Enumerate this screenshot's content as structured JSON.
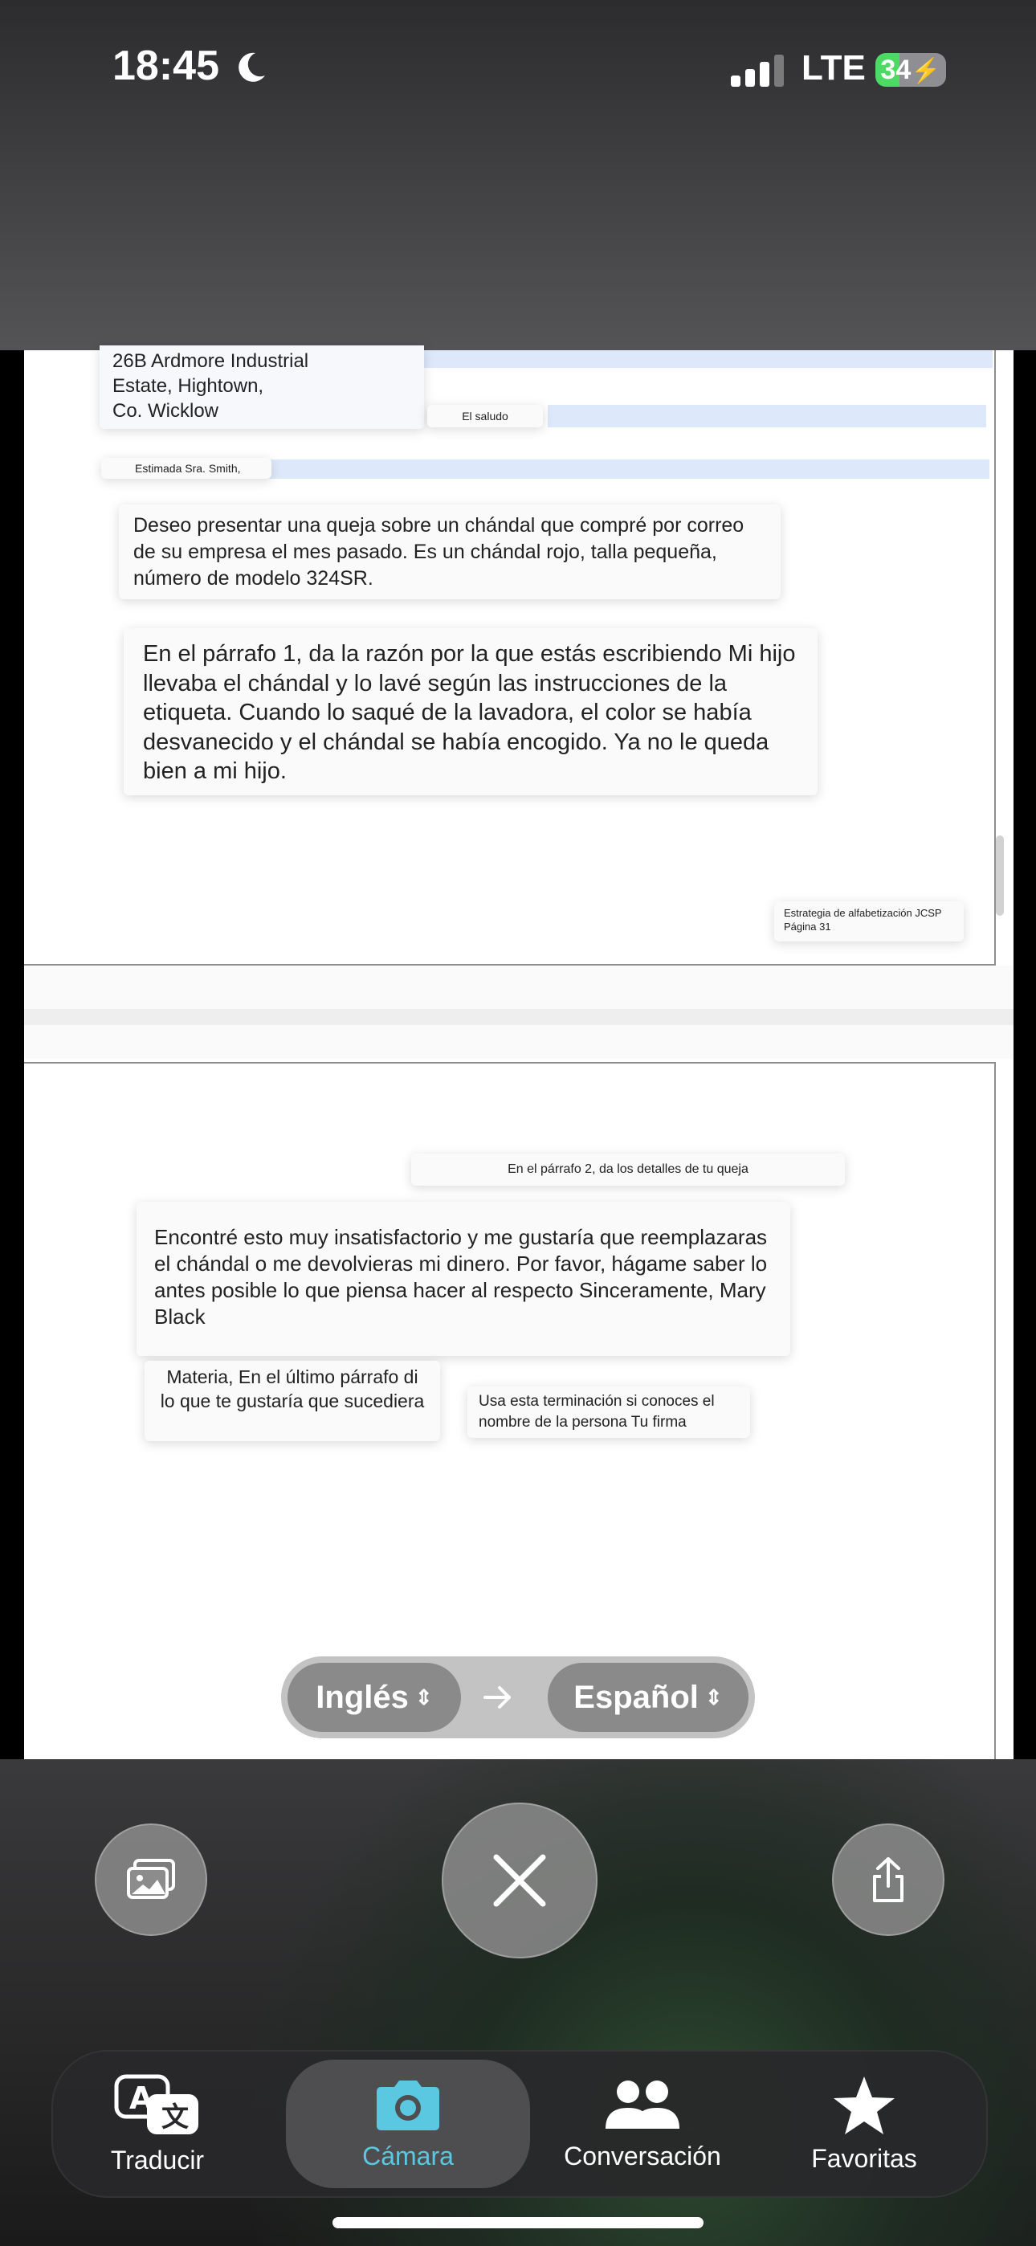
{
  "status_bar": {
    "time": "18:45",
    "network": "LTE",
    "battery": "34"
  },
  "page1": {
    "address_lines": [
      "26B Ardmore Industrial",
      "Estate, Hightown,",
      "Co. Wicklow"
    ],
    "greeting_tag": "El saludo",
    "salutation": "Estimada Sra. Smith,",
    "paragraph1": "Deseo presentar una queja sobre un chándal que compré por correo de su empresa el mes pasado. Es un chándal rojo, talla pequeña, número de modelo 324SR.",
    "paragraph2": "En el párrafo 1, da la razón por la que estás escribiendo Mi hijo llevaba el chándal y lo lavé según las instrucciones de la etiqueta. Cuando lo saqué de la lavadora, el color se había desvanecido y el chándal se había encogido. Ya no le queda bien a mi hijo.",
    "footer_lines": [
      "Estrategia de alfabetización JCSP",
      "Página 31"
    ]
  },
  "page2": {
    "paragraph2_tip": "En el párrafo 2, da los detalles de tu queja",
    "paragraph3": "Encontré esto muy insatisfactorio y me gustaría que reemplazaras el chándal o me devolvieras mi dinero. Por favor, hágame saber lo antes posible lo que piensa hacer al respecto Sinceramente, Mary Black",
    "last_paragraph_tip": "Materia, En el último párrafo di lo que te gustaría que sucediera",
    "ending_tip": "Usa esta terminación si conoces el nombre de la persona Tu firma"
  },
  "language_picker": {
    "source": "Inglés",
    "target": "Español"
  },
  "tabs": [
    {
      "label": "Traducir",
      "icon": "translate-icon"
    },
    {
      "label": "Cámara",
      "icon": "camera-icon",
      "selected": true
    },
    {
      "label": "Conversación",
      "icon": "people-icon"
    },
    {
      "label": "Favoritas",
      "icon": "star-icon"
    }
  ],
  "colors": {
    "accent": "#5ac8e0",
    "card": "#fafafa",
    "highlight_band": "#dde9fb"
  }
}
